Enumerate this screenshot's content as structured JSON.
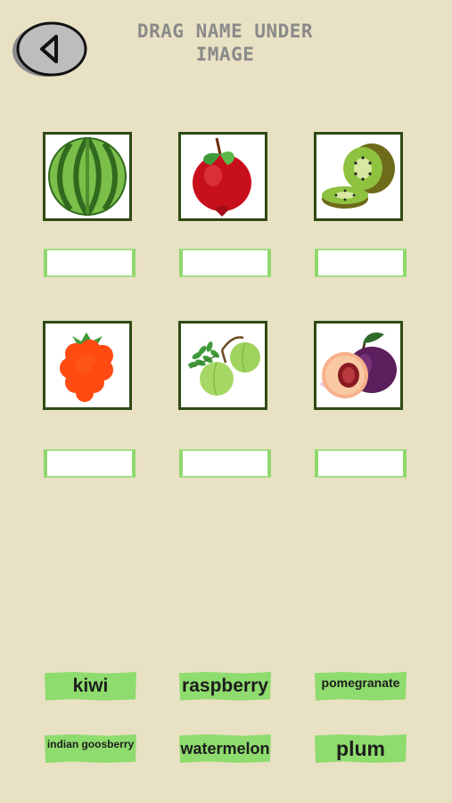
{
  "header": {
    "title_line1": "DRAG NAME UNDER",
    "title_line2": "IMAGE"
  },
  "images": [
    {
      "name": "watermelon-icon"
    },
    {
      "name": "pomegranate-icon"
    },
    {
      "name": "kiwi-icon"
    },
    {
      "name": "raspberry-icon"
    },
    {
      "name": "indian-gooseberry-icon"
    },
    {
      "name": "plum-icon"
    }
  ],
  "labels": [
    "kiwi",
    "raspberry",
    "pomegranate",
    "indian goosberry",
    "watermelon",
    "plum"
  ],
  "colors": {
    "background": "#e8e1c4",
    "card_border": "#2f4a14",
    "label_bg": "#8edc6d",
    "slot_border": "#8fd86c",
    "title": "#8a8a8a"
  }
}
